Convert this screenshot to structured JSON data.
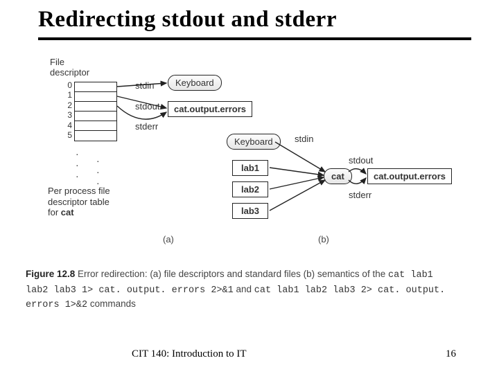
{
  "title": "Redirecting stdout and stderr",
  "fig": {
    "fd_label_l1": "File",
    "fd_label_l2": "descriptor",
    "nums": [
      "0",
      "1",
      "2",
      "3",
      "4",
      "5"
    ],
    "perproc_l1": "Per process file",
    "perproc_l2": "descriptor table",
    "perproc_l3_a": "for ",
    "perproc_l3_b": "cat",
    "stdin": "stdin",
    "stdout": "stdout",
    "stderr": "stderr",
    "keyboard": "Keyboard",
    "coe": "cat.output.errors",
    "lab1": "lab1",
    "lab2": "lab2",
    "lab3": "lab3",
    "cat": "cat",
    "cap_a": "(a)",
    "cap_b": "(b)"
  },
  "caption": {
    "lead_bold": "Figure 12.8",
    "text1": "  Error redirection: (a) file descriptors and standard files (b) semantics of the ",
    "mono1": "cat lab1 lab2 lab3 1> cat. output. errors 2>&1",
    "mid": " and ",
    "mono2": "cat lab1 lab2 lab3 2> cat. output. errors 1>&2",
    "tail": " commands"
  },
  "footer": {
    "course": "CIT 140: Introduction to IT",
    "page": "16"
  }
}
